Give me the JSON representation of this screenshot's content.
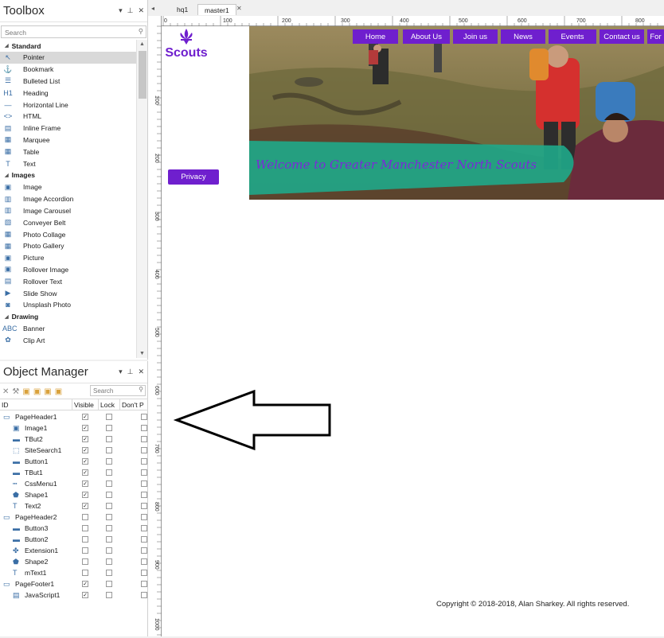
{
  "toolbox": {
    "title": "Toolbox",
    "search_placeholder": "Search",
    "groups": [
      {
        "name": "Standard",
        "items": [
          {
            "label": "Pointer",
            "icon": "pointer-icon",
            "glyph": "↖"
          },
          {
            "label": "Bookmark",
            "icon": "anchor-icon",
            "glyph": "⚓"
          },
          {
            "label": "Bulleted List",
            "icon": "list-icon",
            "glyph": "☰"
          },
          {
            "label": "Heading",
            "icon": "heading-icon",
            "glyph": "H1"
          },
          {
            "label": "Horizontal Line",
            "icon": "line-icon",
            "glyph": "—"
          },
          {
            "label": "HTML",
            "icon": "code-icon",
            "glyph": "<>"
          },
          {
            "label": "Inline Frame",
            "icon": "frame-icon",
            "glyph": "▤"
          },
          {
            "label": "Marquee",
            "icon": "marquee-icon",
            "glyph": "▦"
          },
          {
            "label": "Table",
            "icon": "table-icon",
            "glyph": "▦"
          },
          {
            "label": "Text",
            "icon": "text-icon",
            "glyph": "T"
          }
        ]
      },
      {
        "name": "Images",
        "items": [
          {
            "label": "Image",
            "icon": "image-icon",
            "glyph": "▣"
          },
          {
            "label": "Image Accordion",
            "icon": "image-accordion-icon",
            "glyph": "▥"
          },
          {
            "label": "Image Carousel",
            "icon": "image-carousel-icon",
            "glyph": "▥"
          },
          {
            "label": "Conveyer Belt",
            "icon": "conveyer-icon",
            "glyph": "▧"
          },
          {
            "label": "Photo Collage",
            "icon": "collage-icon",
            "glyph": "▦"
          },
          {
            "label": "Photo Gallery",
            "icon": "gallery-icon",
            "glyph": "▦"
          },
          {
            "label": "Picture",
            "icon": "picture-icon",
            "glyph": "▣"
          },
          {
            "label": "Rollover Image",
            "icon": "rollover-image-icon",
            "glyph": "▣"
          },
          {
            "label": "Rollover Text",
            "icon": "rollover-text-icon",
            "glyph": "▤"
          },
          {
            "label": "Slide Show",
            "icon": "slideshow-icon",
            "glyph": "▶"
          },
          {
            "label": "Unsplash Photo",
            "icon": "unsplash-icon",
            "glyph": "◙"
          }
        ]
      },
      {
        "name": "Drawing",
        "items": [
          {
            "label": "Banner",
            "icon": "banner-icon",
            "glyph": "ABC"
          },
          {
            "label": "Clip Art",
            "icon": "clipart-icon",
            "glyph": "✿"
          }
        ]
      }
    ]
  },
  "objmgr": {
    "title": "Object Manager",
    "search_placeholder": "Search",
    "columns": [
      "ID",
      "Visible",
      "Lock",
      "Don't P"
    ],
    "rows": [
      {
        "name": "PageHeader1",
        "indent": 0,
        "icon": "page-header-icon",
        "visible": true
      },
      {
        "name": "Image1",
        "indent": 1,
        "icon": "image-icon",
        "visible": true
      },
      {
        "name": "TBut2",
        "indent": 1,
        "icon": "button-icon",
        "visible": true
      },
      {
        "name": "SiteSearch1",
        "indent": 1,
        "icon": "search-box-icon",
        "visible": true
      },
      {
        "name": "Button1",
        "indent": 1,
        "icon": "button-icon",
        "visible": true
      },
      {
        "name": "TBut1",
        "indent": 1,
        "icon": "button-icon",
        "visible": true
      },
      {
        "name": "CssMenu1",
        "indent": 1,
        "icon": "menu-icon",
        "visible": true
      },
      {
        "name": "Shape1",
        "indent": 1,
        "icon": "shape-icon",
        "visible": true
      },
      {
        "name": "Text2",
        "indent": 1,
        "icon": "text-icon",
        "visible": true
      },
      {
        "name": "PageHeader2",
        "indent": 0,
        "icon": "page-header-icon",
        "visible": false
      },
      {
        "name": "Button3",
        "indent": 1,
        "icon": "button-icon",
        "visible": false
      },
      {
        "name": "Button2",
        "indent": 1,
        "icon": "button-icon",
        "visible": false
      },
      {
        "name": "Extension1",
        "indent": 1,
        "icon": "extension-icon",
        "visible": false
      },
      {
        "name": "Shape2",
        "indent": 1,
        "icon": "shape-icon",
        "visible": false
      },
      {
        "name": "mText1",
        "indent": 1,
        "icon": "text-icon",
        "visible": false
      },
      {
        "name": "PageFooter1",
        "indent": 0,
        "icon": "page-footer-icon",
        "visible": true
      },
      {
        "name": "JavaScript1",
        "indent": 1,
        "icon": "javascript-icon",
        "visible": true
      }
    ]
  },
  "tabs": [
    "hq1",
    "master1"
  ],
  "ruler": {
    "h": [
      "0",
      "100",
      "200",
      "300",
      "400",
      "500",
      "600",
      "700",
      "800"
    ],
    "v": [
      "100",
      "200",
      "300",
      "400",
      "500",
      "600",
      "700",
      "800",
      "900",
      "1000"
    ]
  },
  "page": {
    "logo_text": "Scouts",
    "nav": [
      "Home",
      "About Us",
      "Join us",
      "News",
      "Events",
      "Contact us",
      "For"
    ],
    "privacy": "Privacy",
    "banner": "Welcome to Greater Manchester North Scouts",
    "footer": "Copyright © 2018-2018, Alan Sharkey. All rights reserved.",
    "accent": "#6f1fce",
    "banner_color": "#1fa88a"
  }
}
